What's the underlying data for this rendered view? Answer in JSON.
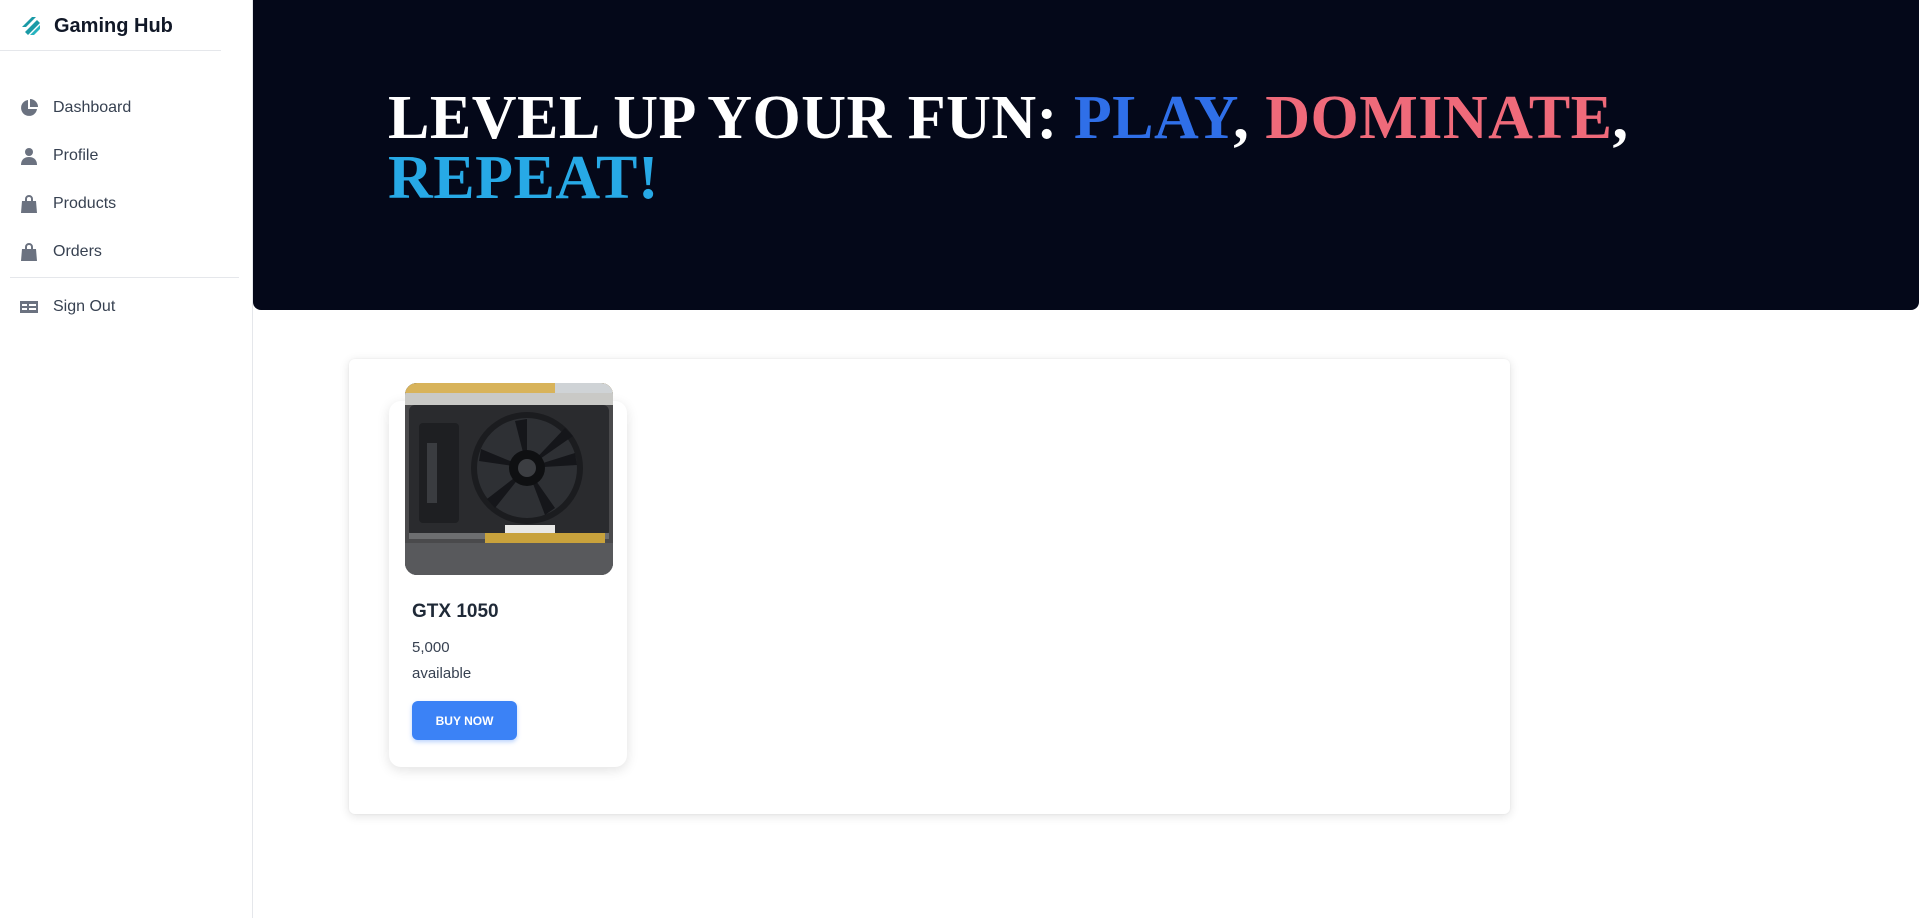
{
  "brand": {
    "name": "Gaming Hub",
    "icon": "stacked-logo-icon",
    "color": "#1a9aa6"
  },
  "sidebar": {
    "items": [
      {
        "label": "Dashboard",
        "icon": "pie-chart-icon"
      },
      {
        "label": "Profile",
        "icon": "user-icon"
      },
      {
        "label": "Products",
        "icon": "shopping-bag-icon"
      },
      {
        "label": "Orders",
        "icon": "shopping-bag-icon"
      }
    ],
    "signout": {
      "label": "Sign Out",
      "icon": "id-card-icon"
    }
  },
  "hero": {
    "part1": "LEVEL UP YOUR FUN: ",
    "play": "PLAY",
    "sep1": ", ",
    "dominate": "DOMINATE",
    "sep2": ",",
    "repeat": "REPEAT!",
    "colors": {
      "background": "#040819",
      "play": "#2f6fe8",
      "dominate": "#ef6a7a",
      "repeat": "#27a9e6"
    }
  },
  "products": [
    {
      "name": "GTX 1050",
      "price": "5,000",
      "availability": "available",
      "button": "BUY NOW",
      "image": "graphics-card-photo"
    }
  ],
  "colors": {
    "accent": "#3b82f6"
  }
}
